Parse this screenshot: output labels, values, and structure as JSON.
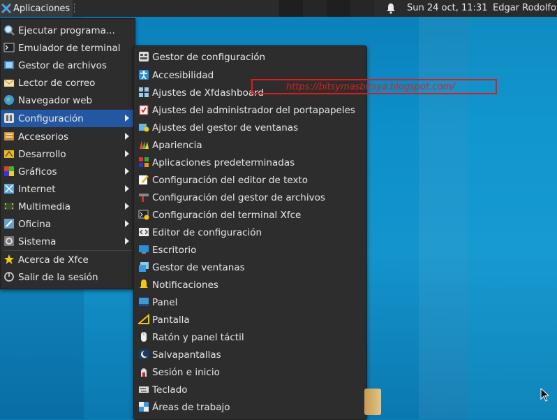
{
  "panel": {
    "apps_label": "Aplicaciones",
    "clock": "Sun 24 oct, 11:31",
    "user": "Edgar Rodolfo"
  },
  "main_menu": {
    "items": [
      {
        "label": "Ejecutar programa...",
        "icon": "run-search-icon",
        "submenu": false
      },
      {
        "label": "Emulador de terminal",
        "icon": "terminal-icon",
        "submenu": false
      },
      {
        "label": "Gestor de archivos",
        "icon": "file-manager-icon",
        "submenu": false
      },
      {
        "label": "Lector de correo",
        "icon": "mail-icon",
        "submenu": false
      },
      {
        "label": "Navegador web",
        "icon": "web-browser-icon",
        "submenu": false
      },
      {
        "label": "Configuración",
        "icon": "settings-icon",
        "submenu": true,
        "active": true
      },
      {
        "label": "Accesorios",
        "icon": "accessories-icon",
        "submenu": true
      },
      {
        "label": "Desarrollo",
        "icon": "development-icon",
        "submenu": true
      },
      {
        "label": "Gráficos",
        "icon": "graphics-icon",
        "submenu": true
      },
      {
        "label": "Internet",
        "icon": "internet-icon",
        "submenu": true
      },
      {
        "label": "Multimedia",
        "icon": "multimedia-icon",
        "submenu": true
      },
      {
        "label": "Oficina",
        "icon": "office-icon",
        "submenu": true
      },
      {
        "label": "Sistema",
        "icon": "system-icon",
        "submenu": true
      },
      {
        "label": "Acerca de Xfce",
        "icon": "star-icon",
        "submenu": false
      },
      {
        "label": "Salir de la sesión",
        "icon": "logout-icon",
        "submenu": false
      }
    ]
  },
  "settings_menu": {
    "items": [
      {
        "label": "Gestor de configuración",
        "icon": "settings-manager-icon"
      },
      {
        "label": "Accesibilidad",
        "icon": "accessibility-icon"
      },
      {
        "label": "Ajustes de Xfdashboard",
        "icon": "dashboard-icon"
      },
      {
        "label": "Ajustes del administrador del portapapeles",
        "icon": "clipboard-icon"
      },
      {
        "label": "Ajustes del gestor de ventanas",
        "icon": "window-tweaks-icon"
      },
      {
        "label": "Apariencia",
        "icon": "appearance-icon"
      },
      {
        "label": "Aplicaciones predeterminadas",
        "icon": "default-apps-icon"
      },
      {
        "label": "Configuración del editor de texto",
        "icon": "text-editor-icon"
      },
      {
        "label": "Configuración del gestor de archivos",
        "icon": "file-manager-settings-icon"
      },
      {
        "label": "Configuración del terminal Xfce",
        "icon": "terminal-settings-icon"
      },
      {
        "label": "Editor de configuración",
        "icon": "config-editor-icon"
      },
      {
        "label": "Escritorio",
        "icon": "desktop-icon"
      },
      {
        "label": "Gestor de ventanas",
        "icon": "window-manager-icon"
      },
      {
        "label": "Notificaciones",
        "icon": "bell-icon"
      },
      {
        "label": "Panel",
        "icon": "panel-icon"
      },
      {
        "label": "Pantalla",
        "icon": "display-icon"
      },
      {
        "label": "Ratón y panel táctil",
        "icon": "mouse-icon"
      },
      {
        "label": "Salvapantallas",
        "icon": "screensaver-icon"
      },
      {
        "label": "Sesión e inicio",
        "icon": "session-icon"
      },
      {
        "label": "Teclado",
        "icon": "keyboard-icon"
      },
      {
        "label": "Áreas de trabajo",
        "icon": "workspaces-icon"
      }
    ]
  },
  "overlay": {
    "url": "https://bitsymasbitsya.blogspot.com/"
  },
  "colors": {
    "active_item": "#2357a2",
    "menu_bg": "#2d2d2d",
    "url_red": "#e01e1e"
  }
}
